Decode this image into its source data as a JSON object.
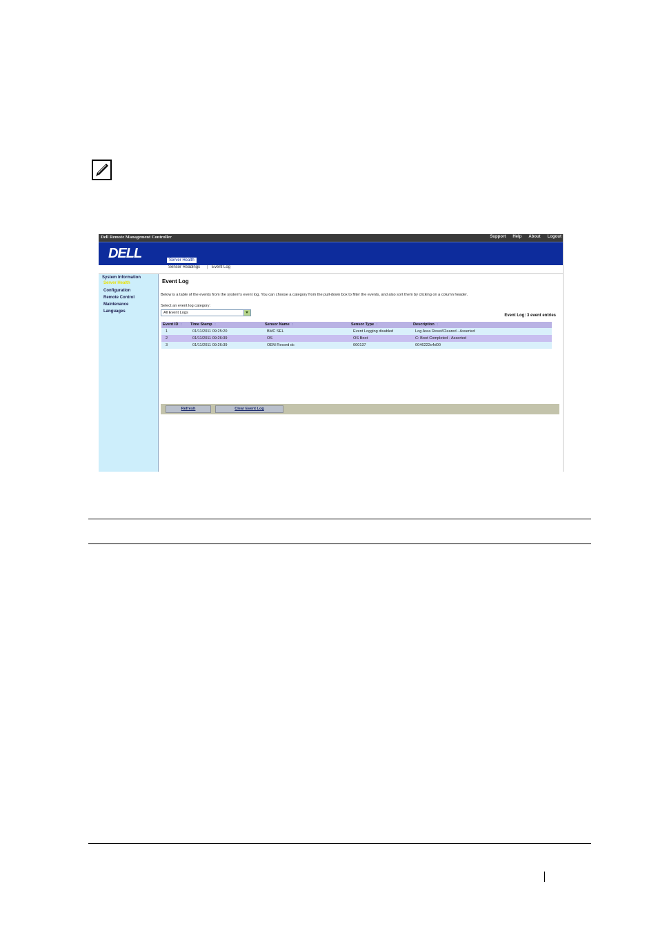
{
  "doc": {
    "note_icon": "pencil-note-icon"
  },
  "app": {
    "title": "Dell Remote Management Controller",
    "top_links": [
      "Support",
      "Help",
      "About",
      "Logout"
    ],
    "logo": "DELL",
    "active_tab": "Server Health",
    "subnav": [
      "Sensor Readings",
      "Event Log"
    ],
    "colors": {
      "banner": "#0d2c9c",
      "sidebar": "#cdeefb",
      "header_row": "#b9b2e4"
    }
  },
  "sidebar": {
    "items": [
      {
        "label": "System Information",
        "active": false
      },
      {
        "label": "Server Health",
        "active": true
      },
      {
        "label": "Configuration",
        "active": false
      },
      {
        "label": "Remote Control",
        "active": false
      },
      {
        "label": "Maintenance",
        "active": false
      },
      {
        "label": "Languages",
        "active": false
      }
    ]
  },
  "content": {
    "title": "Event Log",
    "description": "Below is a table of the events from the system's event log. You can choose a category from the pull-down box to filter the events, and also sort them by clicking on a column header.",
    "select_label": "Select an event log category:",
    "select_value": "All Event Logs",
    "count_text": "Event Log: 3 event entries",
    "columns": [
      "Event ID",
      "Time Stamp",
      "Sensor Name",
      "Sensor Type",
      "Description"
    ],
    "rows": [
      [
        "1",
        "01/11/2011 09:25:20",
        "BMC SEL",
        "Event Logging disabled",
        "Log Area Reset/Cleared - Asserted"
      ],
      [
        "2",
        "01/11/2011 09:26:39",
        "OS",
        "OS Boot",
        "C: Boot Completed - Asserted"
      ],
      [
        "3",
        "01/11/2011 09:26:39",
        "OEM Record dc",
        "000137",
        "0046222c4d00"
      ]
    ],
    "buttons": {
      "refresh": "Refresh",
      "clear": "Clear Event Log"
    }
  }
}
